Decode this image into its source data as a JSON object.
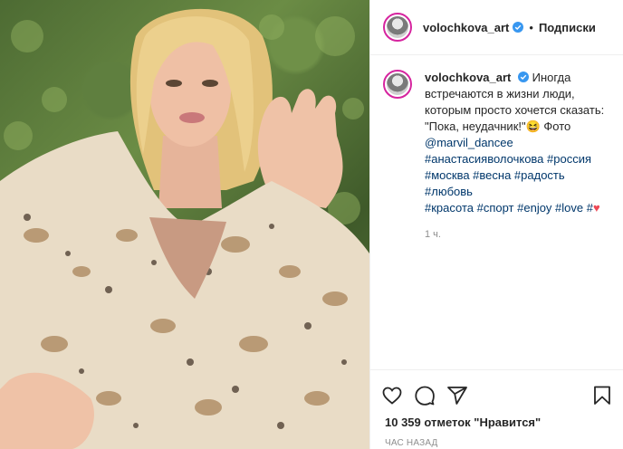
{
  "post": {
    "username": "volochkova_art",
    "separator": "•",
    "follow_label": "Подписки",
    "caption": {
      "line1": "Иногда",
      "line2": "встречаются в жизни люди,",
      "line3": "которым просто хочется сказать:",
      "line4_text": "\"Пока, неудачник!\"",
      "line4_emoji": "😆",
      "line4_after": " Фото",
      "mention": "@marvil_dancee",
      "hashtags_line1": "#анастасияволочкова #россия",
      "hashtags_line2": "#москва #весна #радость #любовь",
      "hashtags_line3": "#красота #спорт #enjoy #love #",
      "heart": "♥"
    },
    "time": "1 ч.",
    "likes_text": "10 359 отметок \"Нравится\"",
    "ago_text": "ЧАС НАЗАД"
  },
  "icons": {
    "like": "heart-icon",
    "comment": "comment-icon",
    "share": "share-icon",
    "save": "bookmark-icon",
    "verified": "verified-badge-icon"
  },
  "colors": {
    "link": "#00376b",
    "verified": "#3897f0",
    "story_ring": "#d6249f",
    "muted": "#8e8e8e"
  }
}
